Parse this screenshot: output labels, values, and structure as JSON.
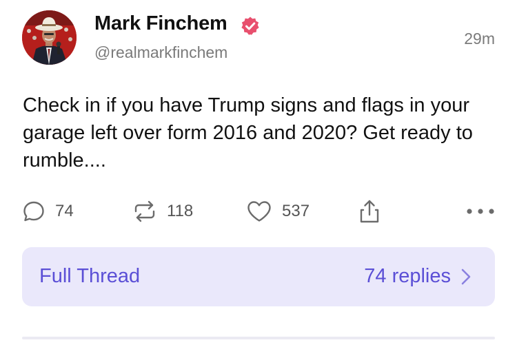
{
  "post": {
    "author": {
      "display_name": "Mark Finchem",
      "handle": "@realmarkfinchem",
      "verified": true
    },
    "timestamp": "29m",
    "text": "Check in if you have Trump signs and flags in your garage left over form 2016 and 2020? Get ready to rumble....",
    "actions": {
      "replies": "74",
      "reposts": "118",
      "likes": "537"
    }
  },
  "thread": {
    "label": "Full Thread",
    "replies": "74 replies"
  },
  "colors": {
    "accent": "#5b4fd6",
    "thread_bg": "#eae8fb",
    "verified_badge": "#e8506e",
    "muted_text": "#7a7a7a"
  },
  "icons": {
    "reply": "comment-bubble-icon",
    "repost": "repost-arrows-icon",
    "like": "heart-icon",
    "share": "share-upload-icon",
    "more": "more-dots-icon",
    "verified": "verified-badge-icon",
    "chevron": "chevron-right-icon"
  }
}
